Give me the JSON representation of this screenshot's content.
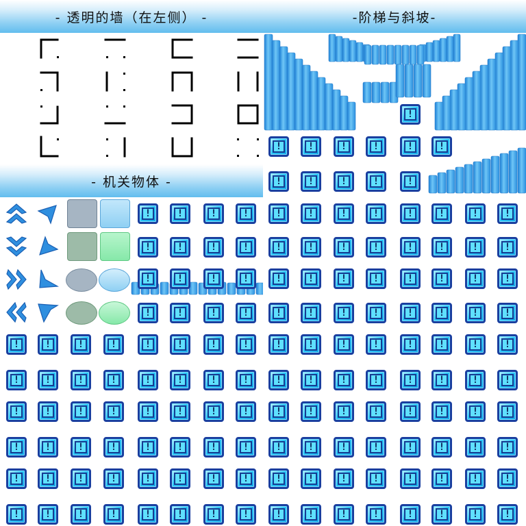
{
  "sheet": {
    "title_walls": "- 透明的墙（在左侧） -",
    "title_stairs": "-阶梯与斜坡-",
    "title_mechanisms": "- 机关物体 -"
  },
  "tile": {
    "glyph": "!"
  },
  "arrow_icons": [
    "chevrons-up-icon",
    "corner-arrow-up-right-icon",
    "chevrons-down-icon",
    "corner-arrow-down-left-icon",
    "chevrons-right-icon",
    "corner-arrow-down-left-outline-icon",
    "chevrons-left-icon",
    "corner-arrow-up-left-icon"
  ],
  "colors": {
    "header_gradient_bottom": "#62bdee",
    "tile_fill": "#29c6f7",
    "tile_border": "#1a3f9f",
    "pillar_blue": "#3aa6ea",
    "block_gray": "#a6b5c3",
    "block_blue": "#9dd6f7",
    "block_gray_green": "#9dbba8",
    "block_green": "#98edb6",
    "oval_gray": "#a6b5c3",
    "oval_blue": "#a8dcf8",
    "oval_gray_green": "#9dbba8",
    "oval_green": "#98edb6"
  }
}
